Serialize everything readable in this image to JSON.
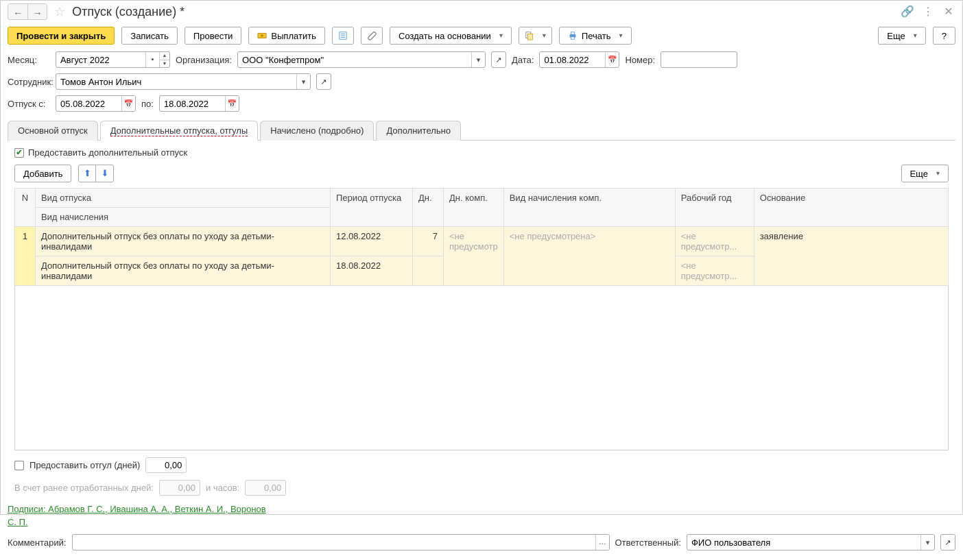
{
  "title": "Отпуск (создание) *",
  "toolbar": {
    "post_close": "Провести и закрыть",
    "save": "Записать",
    "post": "Провести",
    "pay": "Выплатить",
    "create_based": "Создать на основании",
    "print": "Печать",
    "more": "Еще",
    "help": "?"
  },
  "form": {
    "month_label": "Месяц:",
    "month_value": "Август 2022",
    "org_label": "Организация:",
    "org_value": "ООО \"Конфетпром\"",
    "date_label": "Дата:",
    "date_value": "01.08.2022",
    "number_label": "Номер:",
    "number_value": "",
    "employee_label": "Сотрудник:",
    "employee_value": "Томов Антон Ильич",
    "vacation_from_label": "Отпуск с:",
    "vacation_from_value": "05.08.2022",
    "vacation_to_label": "по:",
    "vacation_to_value": "18.08.2022"
  },
  "tabs": {
    "t1": "Основной отпуск",
    "t2": "Дополнительные отпуска, отгулы",
    "t3": "Начислено (подробно)",
    "t4": "Дополнительно"
  },
  "tab2": {
    "checkbox_label": "Предоставить дополнительный отпуск",
    "add_btn": "Добавить",
    "more_btn": "Еще",
    "headers": {
      "n": "N",
      "type": "Вид отпуска",
      "accrual": "Вид начисления",
      "period": "Период отпуска",
      "days": "Дн.",
      "days_comp": "Дн. комп.",
      "comp_accrual": "Вид начисления комп.",
      "work_year": "Рабочий год",
      "basis": "Основание"
    },
    "row": {
      "n": "1",
      "type": "Дополнительный отпуск без оплаты по уходу за детьми-инвалидами",
      "accrual": "Дополнительный отпуск без оплаты по уходу за детьми-инвалидами",
      "period_from": "12.08.2022",
      "period_to": "18.08.2022",
      "days": "7",
      "days_comp": "<не предусмотр",
      "comp_accrual": "<не предусмотрена>",
      "work_year": "<не предусмотр...",
      "work_year2": "<не предусмотр...",
      "basis": "заявление"
    },
    "otgul_label": "Предоставить отгул (дней)",
    "otgul_value": "0,00",
    "prev_days_label": "В счет ранее отработанных дней:",
    "prev_days_value": "0,00",
    "prev_hours_label": "и часов:",
    "prev_hours_value": "0,00"
  },
  "signatures": {
    "line1": "Подписи: Абрамов Г. С., Ивашина А. А., Веткин А. И., Воронов",
    "line2": "С. П."
  },
  "footer": {
    "comment_label": "Комментарий:",
    "responsible_label": "Ответственный:",
    "responsible_value": "ФИО пользователя"
  }
}
